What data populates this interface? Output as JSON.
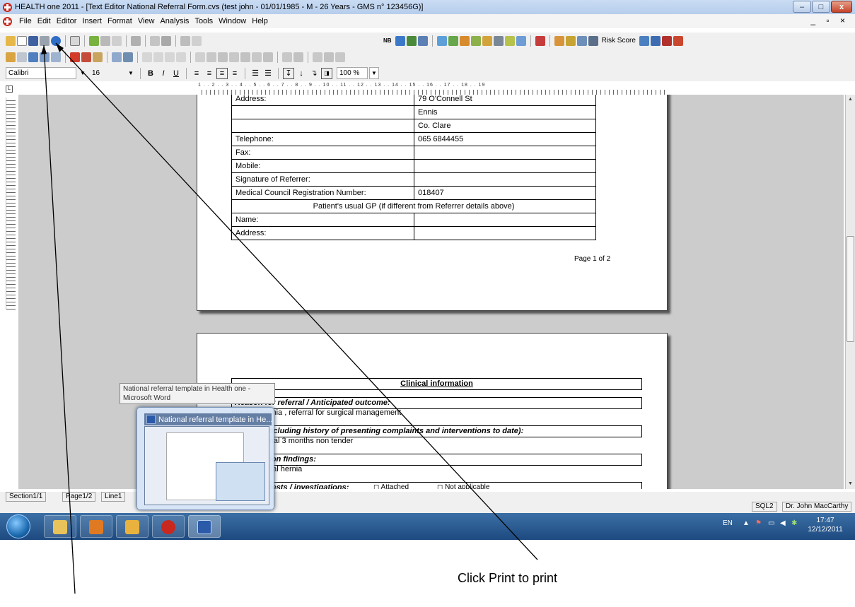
{
  "window": {
    "title": "HEALTH one 2011 - [Text Editor National Referral Form.cvs (test john - 01/01/1985 - M - 26 Years - GMS n° 123456G)]",
    "minimize": "–",
    "maximize": "□",
    "close": "x"
  },
  "menu": [
    "File",
    "Edit",
    "Editor",
    "Insert",
    "Format",
    "View",
    "Analysis",
    "Tools",
    "Window",
    "Help"
  ],
  "mdi_controls": "_ ▫ ×",
  "toolbar": {
    "nb_label": "NB",
    "risk_score_label": "Risk Score"
  },
  "format_bar": {
    "font_name": "Calibri",
    "font_size": "16",
    "zoom": "100 %",
    "bold": "B",
    "italic": "I",
    "underline": "U"
  },
  "ruler_labels": "1 . . 2 . . 3 . . 4 . . 5 . . 6 . . 7 . . 8 . . 9 . . 10 . . 11 . . 12 . . 13 . . 14 . . 15 . . 16 . . 17 . . 18 . . 19",
  "page1": {
    "rows": [
      {
        "label": "Address:",
        "value": "79 O'Connell St"
      },
      {
        "label": "",
        "value": "Ennis"
      },
      {
        "label": "",
        "value": "Co. Clare"
      },
      {
        "label": "Telephone:",
        "value": "065 6844455"
      },
      {
        "label": "Fax:",
        "value": ""
      },
      {
        "label": "Mobile:",
        "value": ""
      },
      {
        "label": "Signature of Referrer:",
        "value": ""
      },
      {
        "label": "Medical Council Registration Number:",
        "value": "018407"
      }
    ],
    "gp_header": "Patient's usual GP (if different from Referrer details above)",
    "gp_rows": [
      {
        "label": "Name:",
        "value": ""
      },
      {
        "label": "Address:",
        "value": ""
      }
    ],
    "page_number": "Page 1 of 2"
  },
  "page2": {
    "clinical_header": "Clinical information",
    "reason_label": "Reason for referral / Anticipated outcome:",
    "reason_text": "Inguinal hernia , referral for surgical management",
    "history_label": "History (including history of presenting complaints and interventions to date):",
    "history_text": "Lump inguinal 3 months non tender",
    "findings_label": "Examination findings:",
    "findings_text": "Right inguinal hernia",
    "tests_label": "Relevant tests / investigations:",
    "attached": "◻ Attached",
    "not_applicable": "◻ Not applicable"
  },
  "status": {
    "section": "Section1/1",
    "page": "Page1/2",
    "line": "Line1",
    "sql": "SQL2",
    "user": "Dr. John MacCarthy"
  },
  "tooltip": {
    "text": "National referral template in Health one - Microsoft Word"
  },
  "preview": {
    "title": "National referral template in He..."
  },
  "taskbar": {
    "lang": "EN",
    "time": "17:47",
    "date": "12/12/2011"
  },
  "annotation": {
    "text": "Click Print to print"
  },
  "colors": {
    "titlebar": "#c9dcf3",
    "workspace": "#cccccc",
    "taskbar": "#2a5a92",
    "health_red": "#c8281e"
  }
}
